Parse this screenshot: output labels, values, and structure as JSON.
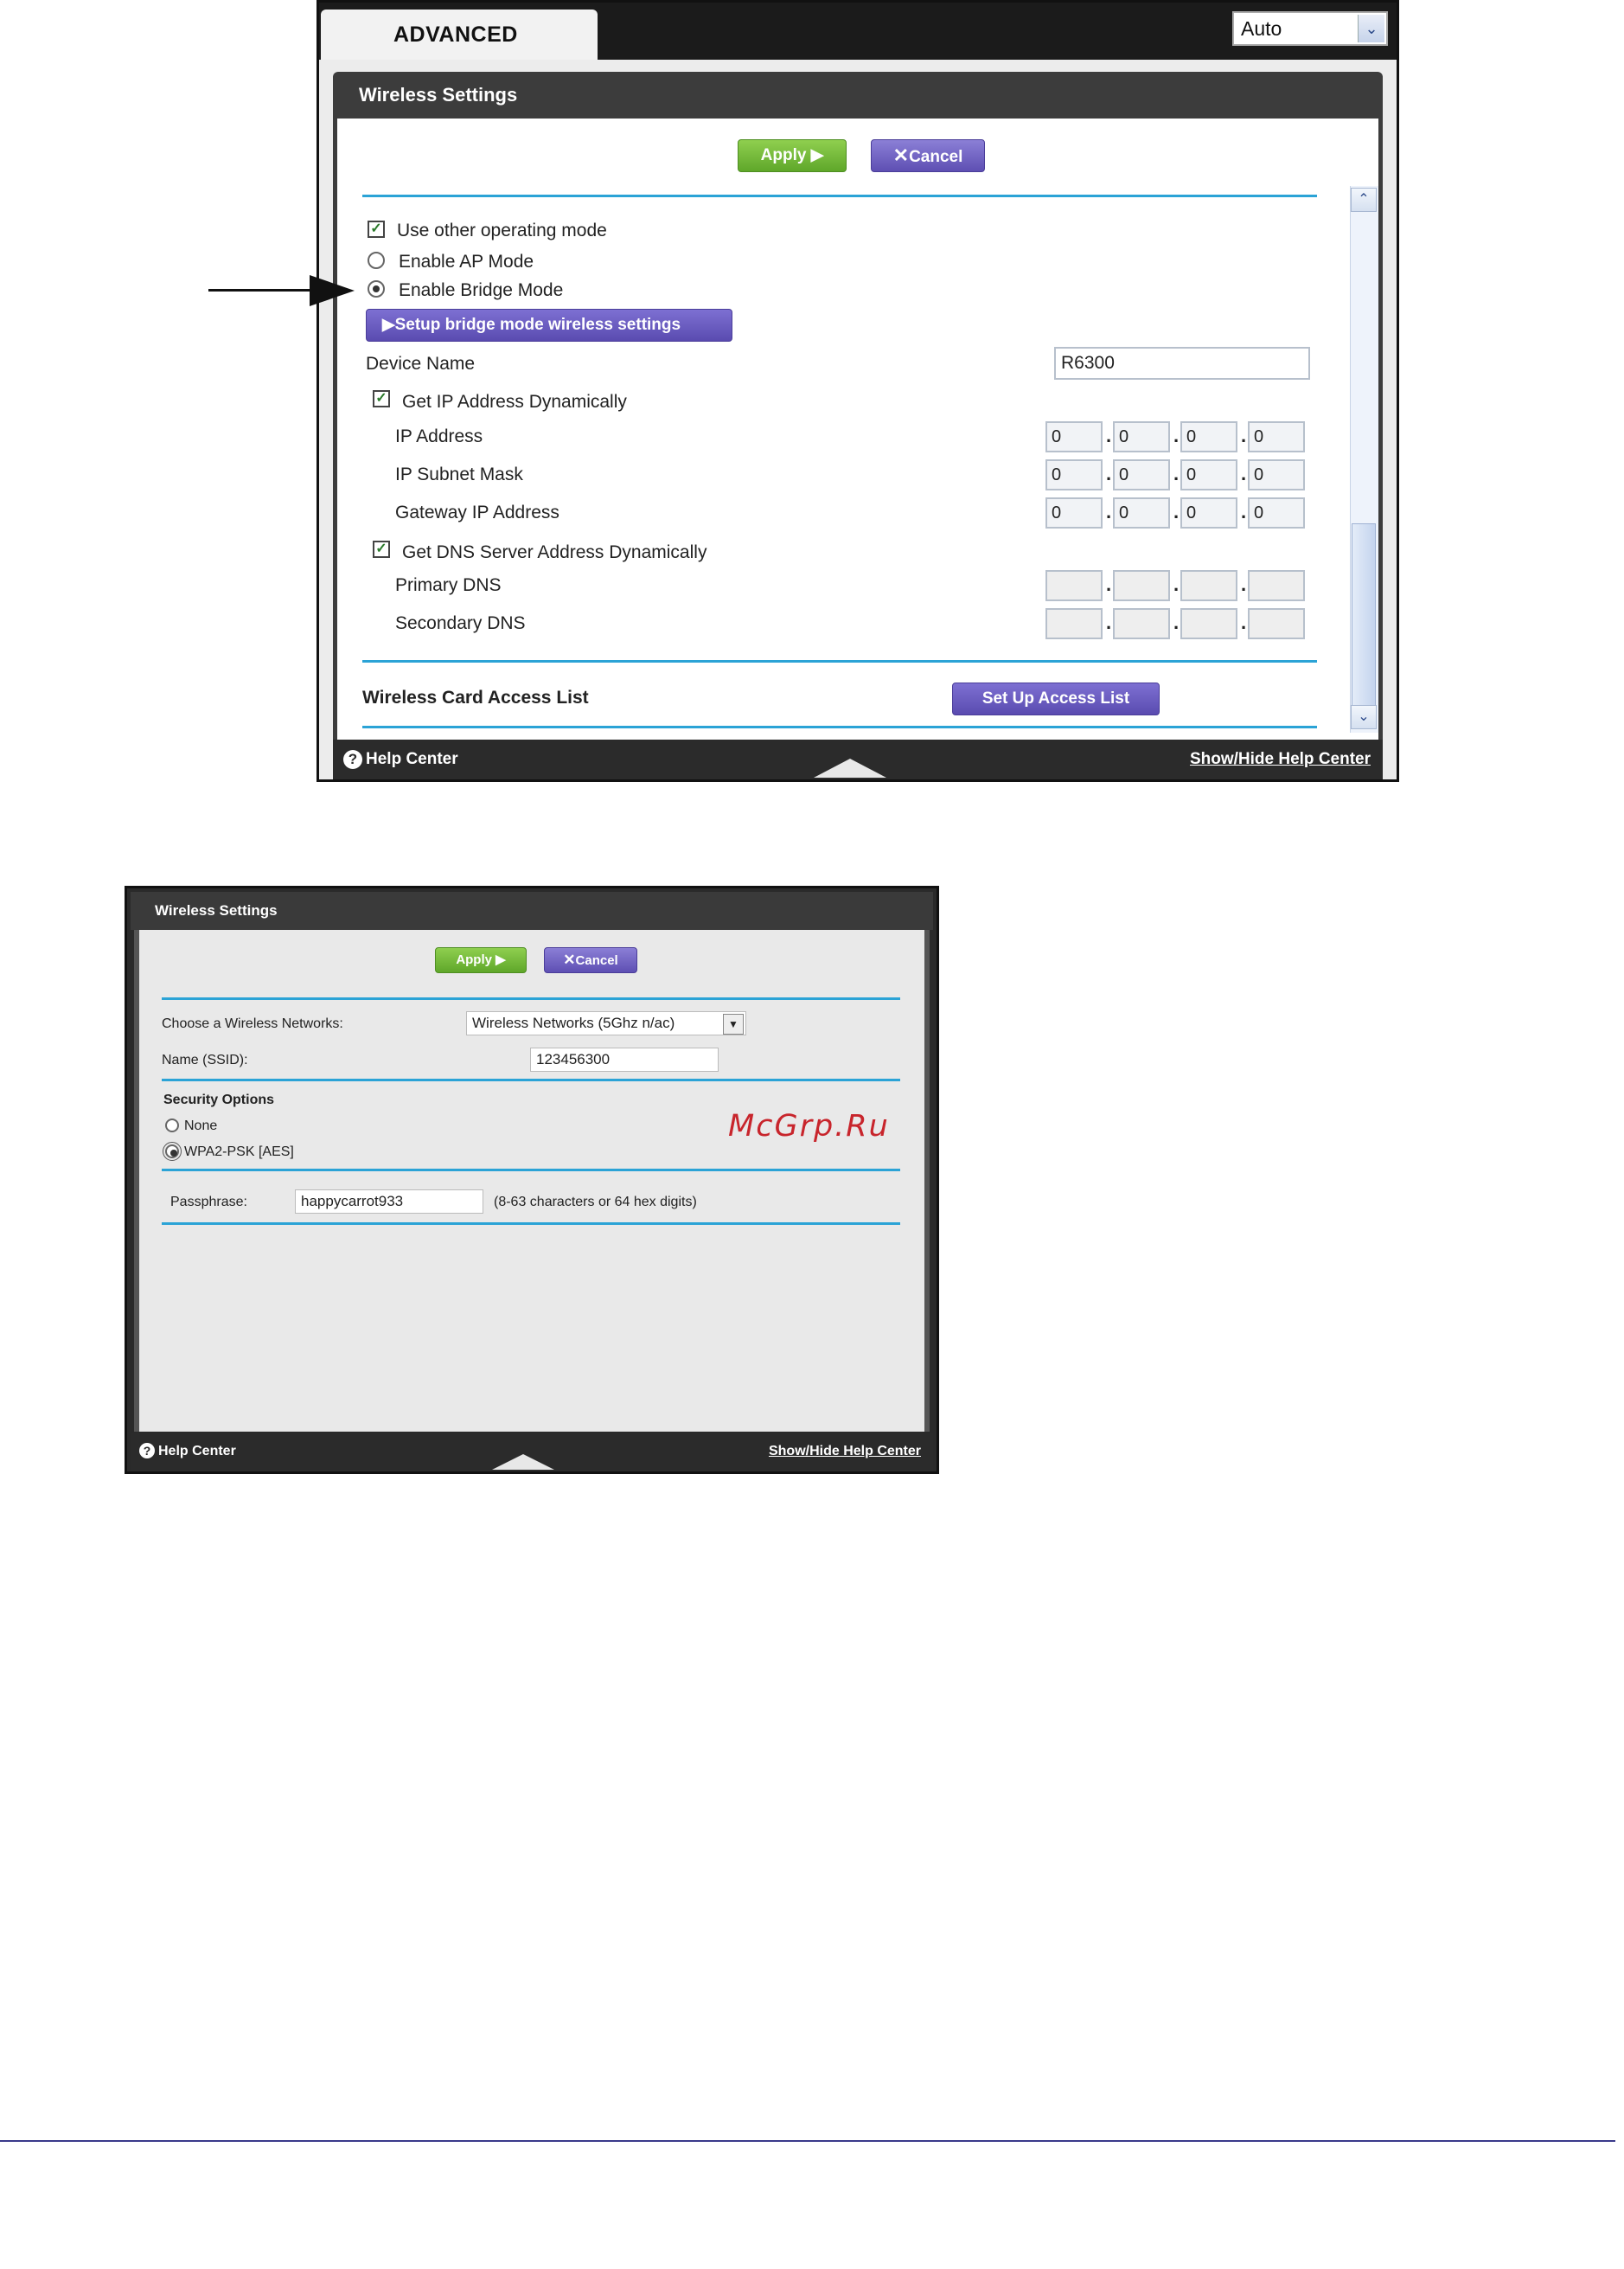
{
  "screen1": {
    "tab_label": "ADVANCED",
    "mode_select_value": "Auto",
    "panel_title": "Wireless Settings",
    "apply_label": "Apply ▶",
    "cancel_label": "Cancel",
    "use_other_mode_label": "Use other operating mode",
    "ap_mode_label": "Enable AP Mode",
    "bridge_mode_label": "Enable Bridge Mode",
    "setup_bridge_button": "▶Setup bridge mode wireless settings",
    "device_name_label": "Device Name",
    "device_name_value": "R6300",
    "get_ip_dyn_label": "Get IP Address Dynamically",
    "ip_rows": [
      {
        "label": "IP Address",
        "octets": [
          "0",
          "0",
          "0",
          "0"
        ]
      },
      {
        "label": "IP Subnet Mask",
        "octets": [
          "0",
          "0",
          "0",
          "0"
        ]
      },
      {
        "label": "Gateway IP Address",
        "octets": [
          "0",
          "0",
          "0",
          "0"
        ]
      }
    ],
    "get_dns_dyn_label": "Get DNS Server Address Dynamically",
    "dns_rows": [
      {
        "label": "Primary DNS",
        "octets": [
          "",
          "",
          "",
          ""
        ]
      },
      {
        "label": "Secondary DNS",
        "octets": [
          "",
          "",
          "",
          ""
        ]
      }
    ],
    "access_list_label": "Wireless Card Access List",
    "access_list_button": "Set Up Access List",
    "help_center_label": "Help Center",
    "show_hide_label": "Show/Hide Help Center",
    "state": {
      "use_other_mode_checked": true,
      "selected_mode": "bridge",
      "get_ip_dyn_checked": true,
      "get_dns_dyn_checked": true
    }
  },
  "screen2": {
    "panel_title": "Wireless Settings",
    "apply_label": "Apply ▶",
    "cancel_label": "Cancel",
    "choose_network_label": "Choose a Wireless Networks:",
    "network_select_value": "Wireless Networks (5Ghz n/ac)",
    "ssid_label": "Name (SSID):",
    "ssid_value": "123456300",
    "security_options_label": "Security Options",
    "security_none_label": "None",
    "security_wpa2_label": "WPA2-PSK [AES]",
    "selected_security": "wpa2",
    "passphrase_label": "Passphrase:",
    "passphrase_value": "happycarrot933",
    "passphrase_hint": "(8-63 characters or 64 hex digits)",
    "help_center_label": "Help Center",
    "show_hide_label": "Show/Hide Help Center"
  },
  "watermark": "McGrp.Ru",
  "colors": {
    "accent_rule": "#2ba3d6",
    "apply_green": "#6db533",
    "cancel_purple": "#6556c1",
    "watermark_red": "#c8252c"
  }
}
